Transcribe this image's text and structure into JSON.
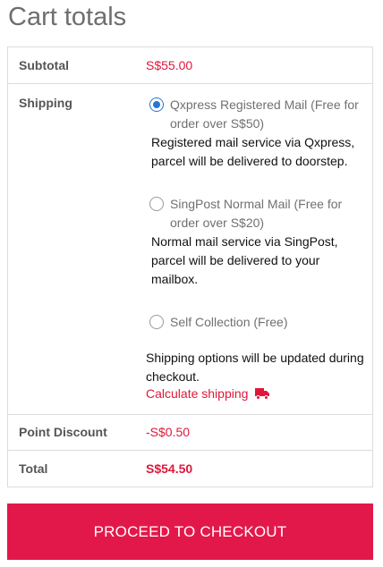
{
  "title": "Cart totals",
  "accent_color": "#e3184a",
  "subtotal": {
    "label": "Subtotal",
    "value": "S$55.00"
  },
  "shipping": {
    "label": "Shipping",
    "options": [
      {
        "name": "Qxpress Registered Mail (Free for order over S$50)",
        "description": "Registered mail service via Qxpress, parcel will be delivered to doorstep.",
        "selected": true
      },
      {
        "name": "SingPost Normal Mail (Free for order over S$20)",
        "description": "Normal mail service via SingPost, parcel will be delivered to your mailbox.",
        "selected": false
      },
      {
        "name": "Self Collection (Free)",
        "description": "",
        "selected": false
      }
    ],
    "note": "Shipping options will be updated during checkout.",
    "calculate_link": "Calculate shipping",
    "calculate_icon": "truck-icon"
  },
  "discount": {
    "label": "Point Discount",
    "value": "-S$0.50"
  },
  "total": {
    "label": "Total",
    "value": "S$54.50"
  },
  "checkout_button": "PROCEED TO CHECKOUT"
}
